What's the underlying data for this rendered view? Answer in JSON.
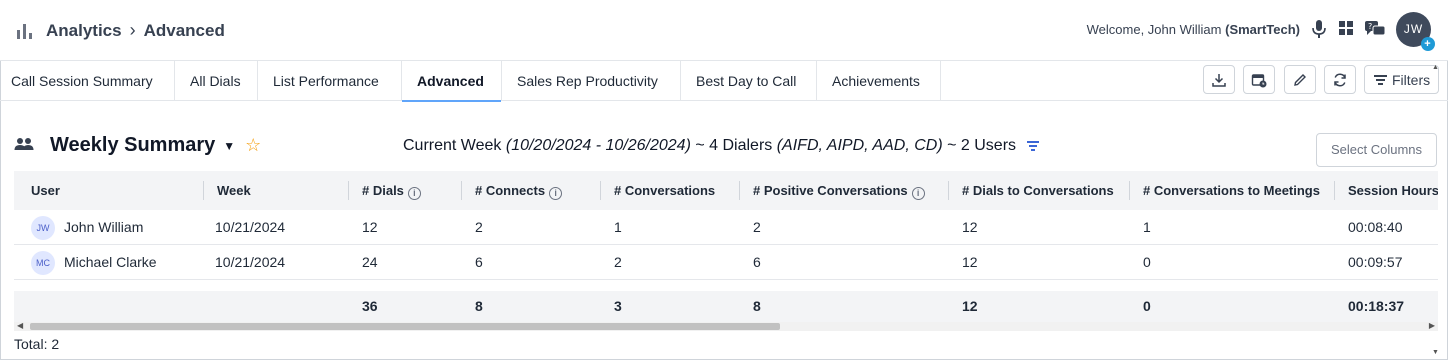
{
  "header": {
    "breadcrumb": [
      "Analytics",
      "Advanced"
    ],
    "welcome_prefix": "Welcome, John William",
    "welcome_org": "(SmartTech)",
    "avatar_initials": "JW",
    "avatar_badge": "+"
  },
  "tabs": [
    {
      "label": "Call Session Summary"
    },
    {
      "label": "All Dials"
    },
    {
      "label": "List Performance"
    },
    {
      "label": "Advanced",
      "active": true
    },
    {
      "label": "Sales Rep Productivity"
    },
    {
      "label": "Best Day to Call"
    },
    {
      "label": "Achievements"
    }
  ],
  "toolbar": {
    "filters_label": "Filters",
    "icons": [
      "download-icon",
      "calendar-clock-icon",
      "edit-icon",
      "refresh-icon",
      "filter-icon"
    ]
  },
  "summary": {
    "title": "Weekly Summary",
    "current_week_label": "Current Week",
    "date_range": "(10/20/2024 - 10/26/2024)",
    "dialers_text": "~ 4 Dialers",
    "dialer_types": "(AIFD, AIPD, AAD, CD)",
    "users_text": "~ 2 Users",
    "select_columns_label": "Select Columns"
  },
  "table": {
    "columns": [
      "User",
      "Week",
      "# Dials",
      "# Connects",
      "# Conversations",
      "# Positive Conversations",
      "# Dials to Conversations",
      "# Conversations to Meetings",
      "Session Hours"
    ],
    "rows": [
      {
        "initials": "JW",
        "user": "John William",
        "week": "10/21/2024",
        "dials": "12",
        "connects": "2",
        "conversations": "1",
        "positive": "2",
        "dials_to_conv": "12",
        "conv_to_meet": "1",
        "hours": "00:08:40"
      },
      {
        "initials": "MC",
        "user": "Michael Clarke",
        "week": "10/21/2024",
        "dials": "24",
        "connects": "6",
        "conversations": "2",
        "positive": "6",
        "dials_to_conv": "12",
        "conv_to_meet": "0",
        "hours": "00:09:57"
      }
    ],
    "totals": {
      "dials": "36",
      "connects": "8",
      "conversations": "3",
      "positive": "8",
      "dials_to_conv": "12",
      "conv_to_meet": "0",
      "hours": "00:18:37"
    }
  },
  "footer": {
    "total_text": "Total: 2"
  }
}
